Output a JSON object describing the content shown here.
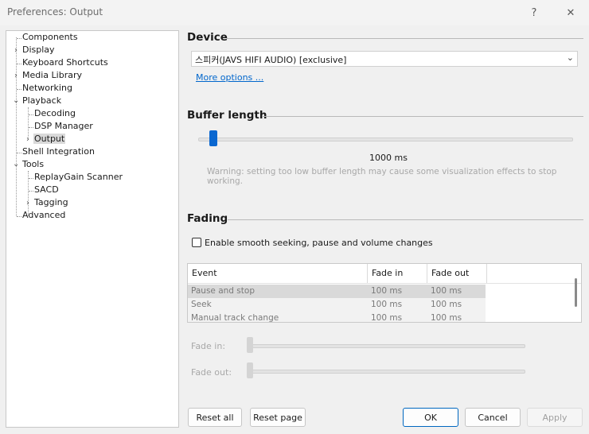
{
  "window": {
    "title": "Preferences: Output",
    "help_label": "?",
    "close_label": "✕"
  },
  "tree": {
    "items": [
      {
        "label": "Components",
        "expand": ""
      },
      {
        "label": "Display",
        "expand": "›"
      },
      {
        "label": "Keyboard Shortcuts",
        "expand": ""
      },
      {
        "label": "Media Library",
        "expand": "›"
      },
      {
        "label": "Networking",
        "expand": ""
      },
      {
        "label": "Playback",
        "expand": "⌄"
      },
      {
        "label": "Decoding",
        "expand": ""
      },
      {
        "label": "DSP Manager",
        "expand": ""
      },
      {
        "label": "Output",
        "expand": "›"
      },
      {
        "label": "Shell Integration",
        "expand": ""
      },
      {
        "label": "Tools",
        "expand": "⌄"
      },
      {
        "label": "ReplayGain Scanner",
        "expand": ""
      },
      {
        "label": "SACD",
        "expand": ""
      },
      {
        "label": "Tagging",
        "expand": "›"
      },
      {
        "label": "Advanced",
        "expand": ""
      }
    ],
    "selected": "Output"
  },
  "device": {
    "heading": "Device",
    "selected_value": "스피커(JAVS HIFI AUDIO) [exclusive]",
    "more_options": "More options ..."
  },
  "buffer": {
    "heading": "Buffer length",
    "value_label": "1000 ms",
    "slider_level": 0.03,
    "warning": "Warning: setting too low buffer length may cause some visualization effects to stop working."
  },
  "fading": {
    "heading": "Fading",
    "checkbox_label": "Enable smooth seeking, pause and volume changes",
    "checkbox_checked": false,
    "columns": [
      "Event",
      "Fade in",
      "Fade out"
    ],
    "rows": [
      {
        "event": "Pause and stop",
        "fade_in": "100 ms",
        "fade_out": "100 ms"
      },
      {
        "event": "Seek",
        "fade_in": "100 ms",
        "fade_out": "100 ms"
      },
      {
        "event": "Manual track change",
        "fade_in": "100 ms",
        "fade_out": "100 ms"
      }
    ],
    "fade_in_label": "Fade in:",
    "fade_out_label": "Fade out:"
  },
  "buttons": {
    "reset_all": "Reset all",
    "reset_page": "Reset page",
    "ok": "OK",
    "cancel": "Cancel",
    "apply": "Apply"
  }
}
